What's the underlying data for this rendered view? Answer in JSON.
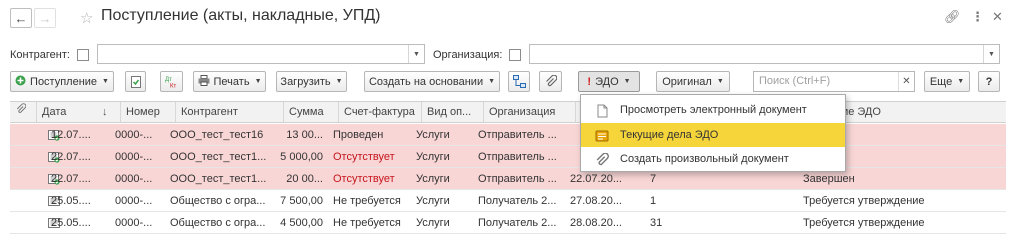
{
  "window": {
    "title": "Поступление (акты, накладные, УПД)",
    "back_icon": "arrow-left-icon",
    "forward_icon": "arrow-right-icon",
    "favorite_icon": "star-icon",
    "link_icon": "link-icon",
    "more_icon": "vertical-dots-icon",
    "close_icon": "close-icon"
  },
  "filters": {
    "counterparty_label": "Контрагент:",
    "organization_label": "Организация:",
    "counterparty_value": "",
    "organization_value": ""
  },
  "toolbar": {
    "receipt": "Поступление",
    "print": "Печать",
    "load": "Загрузить",
    "create_based": "Создать на основании",
    "edo": "ЭДО",
    "original": "Оригинал",
    "search_placeholder": "Поиск (Ctrl+F)",
    "more": "Еще",
    "help": "?",
    "dt_kt_label": "Дт Кт"
  },
  "columns": {
    "date": "Дата",
    "number": "Номер",
    "counterparty": "Контрагент",
    "sum": "Сумма",
    "invoice": "Счет-фактура",
    "op_type": "Вид оп...",
    "organization": "Организация",
    "edo_state": "ние ЭДО"
  },
  "rows": [
    {
      "date": "12.07....",
      "number": "0000-...",
      "counterparty": "ООО_тест_тест16",
      "sum": "13 00...",
      "invoice": "Проведен",
      "op_type": "Услуги",
      "organization": "Отправитель ...",
      "date2": "",
      "count": "",
      "edo": "шен",
      "highlight": true
    },
    {
      "date": "22.07....",
      "number": "0000-...",
      "counterparty": "ООО_тест_тест1...",
      "sum": "5 000,00",
      "invoice": "Отсутствует",
      "op_type": "Услуги",
      "organization": "Отправитель ...",
      "date2": "",
      "count": "",
      "edo": "шен",
      "highlight": true
    },
    {
      "date": "22.07....",
      "number": "0000-...",
      "counterparty": "ООО_тест_тест1...",
      "sum": "20 00...",
      "invoice": "Отсутствует",
      "op_type": "Услуги",
      "organization": "Отправитель ...",
      "date2": "22.07.20...",
      "count": "7",
      "edo": "Завершен",
      "highlight": true
    },
    {
      "date": "25.05....",
      "number": "0000-...",
      "counterparty": "Общество с огра...",
      "sum": "7 500,00",
      "invoice": "Не требуется",
      "op_type": "Услуги",
      "organization": "Получатель 2...",
      "date2": "27.08.20...",
      "count": "1",
      "edo": "Требуется утверждение",
      "highlight": false
    },
    {
      "date": "25.05....",
      "number": "0000-...",
      "counterparty": "Общество с огра...",
      "sum": "4 500,00",
      "invoice": "Не требуется",
      "op_type": "Услуги",
      "organization": "Получатель 2...",
      "date2": "28.08.20...",
      "count": "31",
      "edo": "Требуется утверждение",
      "highlight": false
    }
  ],
  "edo_menu": {
    "items": [
      {
        "label": "Просмотреть электронный документ",
        "icon": "document-icon"
      },
      {
        "label": "Текущие дела ЭДО",
        "icon": "tasks-icon"
      },
      {
        "label": "Создать произвольный документ",
        "icon": "attachment-icon"
      }
    ]
  },
  "colors": {
    "row_highlight": "#f9d6d6",
    "status_red": "#c4161c",
    "menu_active": "#f6d53a"
  }
}
